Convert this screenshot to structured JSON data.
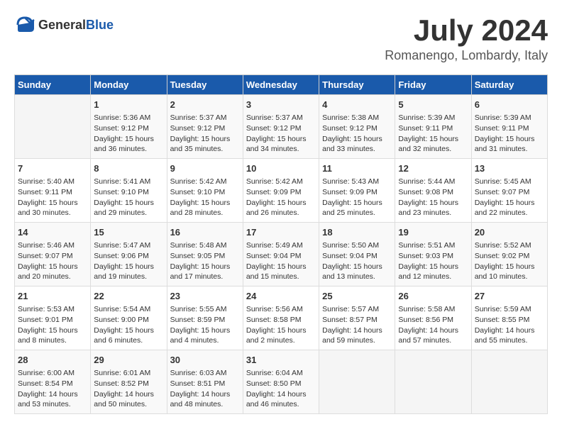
{
  "header": {
    "logo_general": "General",
    "logo_blue": "Blue",
    "title": "July 2024",
    "location": "Romanengo, Lombardy, Italy"
  },
  "calendar": {
    "days_of_week": [
      "Sunday",
      "Monday",
      "Tuesday",
      "Wednesday",
      "Thursday",
      "Friday",
      "Saturday"
    ],
    "weeks": [
      [
        {
          "day": "",
          "info": ""
        },
        {
          "day": "1",
          "info": "Sunrise: 5:36 AM\nSunset: 9:12 PM\nDaylight: 15 hours\nand 36 minutes."
        },
        {
          "day": "2",
          "info": "Sunrise: 5:37 AM\nSunset: 9:12 PM\nDaylight: 15 hours\nand 35 minutes."
        },
        {
          "day": "3",
          "info": "Sunrise: 5:37 AM\nSunset: 9:12 PM\nDaylight: 15 hours\nand 34 minutes."
        },
        {
          "day": "4",
          "info": "Sunrise: 5:38 AM\nSunset: 9:12 PM\nDaylight: 15 hours\nand 33 minutes."
        },
        {
          "day": "5",
          "info": "Sunrise: 5:39 AM\nSunset: 9:11 PM\nDaylight: 15 hours\nand 32 minutes."
        },
        {
          "day": "6",
          "info": "Sunrise: 5:39 AM\nSunset: 9:11 PM\nDaylight: 15 hours\nand 31 minutes."
        }
      ],
      [
        {
          "day": "7",
          "info": "Sunrise: 5:40 AM\nSunset: 9:11 PM\nDaylight: 15 hours\nand 30 minutes."
        },
        {
          "day": "8",
          "info": "Sunrise: 5:41 AM\nSunset: 9:10 PM\nDaylight: 15 hours\nand 29 minutes."
        },
        {
          "day": "9",
          "info": "Sunrise: 5:42 AM\nSunset: 9:10 PM\nDaylight: 15 hours\nand 28 minutes."
        },
        {
          "day": "10",
          "info": "Sunrise: 5:42 AM\nSunset: 9:09 PM\nDaylight: 15 hours\nand 26 minutes."
        },
        {
          "day": "11",
          "info": "Sunrise: 5:43 AM\nSunset: 9:09 PM\nDaylight: 15 hours\nand 25 minutes."
        },
        {
          "day": "12",
          "info": "Sunrise: 5:44 AM\nSunset: 9:08 PM\nDaylight: 15 hours\nand 23 minutes."
        },
        {
          "day": "13",
          "info": "Sunrise: 5:45 AM\nSunset: 9:07 PM\nDaylight: 15 hours\nand 22 minutes."
        }
      ],
      [
        {
          "day": "14",
          "info": "Sunrise: 5:46 AM\nSunset: 9:07 PM\nDaylight: 15 hours\nand 20 minutes."
        },
        {
          "day": "15",
          "info": "Sunrise: 5:47 AM\nSunset: 9:06 PM\nDaylight: 15 hours\nand 19 minutes."
        },
        {
          "day": "16",
          "info": "Sunrise: 5:48 AM\nSunset: 9:05 PM\nDaylight: 15 hours\nand 17 minutes."
        },
        {
          "day": "17",
          "info": "Sunrise: 5:49 AM\nSunset: 9:04 PM\nDaylight: 15 hours\nand 15 minutes."
        },
        {
          "day": "18",
          "info": "Sunrise: 5:50 AM\nSunset: 9:04 PM\nDaylight: 15 hours\nand 13 minutes."
        },
        {
          "day": "19",
          "info": "Sunrise: 5:51 AM\nSunset: 9:03 PM\nDaylight: 15 hours\nand 12 minutes."
        },
        {
          "day": "20",
          "info": "Sunrise: 5:52 AM\nSunset: 9:02 PM\nDaylight: 15 hours\nand 10 minutes."
        }
      ],
      [
        {
          "day": "21",
          "info": "Sunrise: 5:53 AM\nSunset: 9:01 PM\nDaylight: 15 hours\nand 8 minutes."
        },
        {
          "day": "22",
          "info": "Sunrise: 5:54 AM\nSunset: 9:00 PM\nDaylight: 15 hours\nand 6 minutes."
        },
        {
          "day": "23",
          "info": "Sunrise: 5:55 AM\nSunset: 8:59 PM\nDaylight: 15 hours\nand 4 minutes."
        },
        {
          "day": "24",
          "info": "Sunrise: 5:56 AM\nSunset: 8:58 PM\nDaylight: 15 hours\nand 2 minutes."
        },
        {
          "day": "25",
          "info": "Sunrise: 5:57 AM\nSunset: 8:57 PM\nDaylight: 14 hours\nand 59 minutes."
        },
        {
          "day": "26",
          "info": "Sunrise: 5:58 AM\nSunset: 8:56 PM\nDaylight: 14 hours\nand 57 minutes."
        },
        {
          "day": "27",
          "info": "Sunrise: 5:59 AM\nSunset: 8:55 PM\nDaylight: 14 hours\nand 55 minutes."
        }
      ],
      [
        {
          "day": "28",
          "info": "Sunrise: 6:00 AM\nSunset: 8:54 PM\nDaylight: 14 hours\nand 53 minutes."
        },
        {
          "day": "29",
          "info": "Sunrise: 6:01 AM\nSunset: 8:52 PM\nDaylight: 14 hours\nand 50 minutes."
        },
        {
          "day": "30",
          "info": "Sunrise: 6:03 AM\nSunset: 8:51 PM\nDaylight: 14 hours\nand 48 minutes."
        },
        {
          "day": "31",
          "info": "Sunrise: 6:04 AM\nSunset: 8:50 PM\nDaylight: 14 hours\nand 46 minutes."
        },
        {
          "day": "",
          "info": ""
        },
        {
          "day": "",
          "info": ""
        },
        {
          "day": "",
          "info": ""
        }
      ]
    ]
  }
}
